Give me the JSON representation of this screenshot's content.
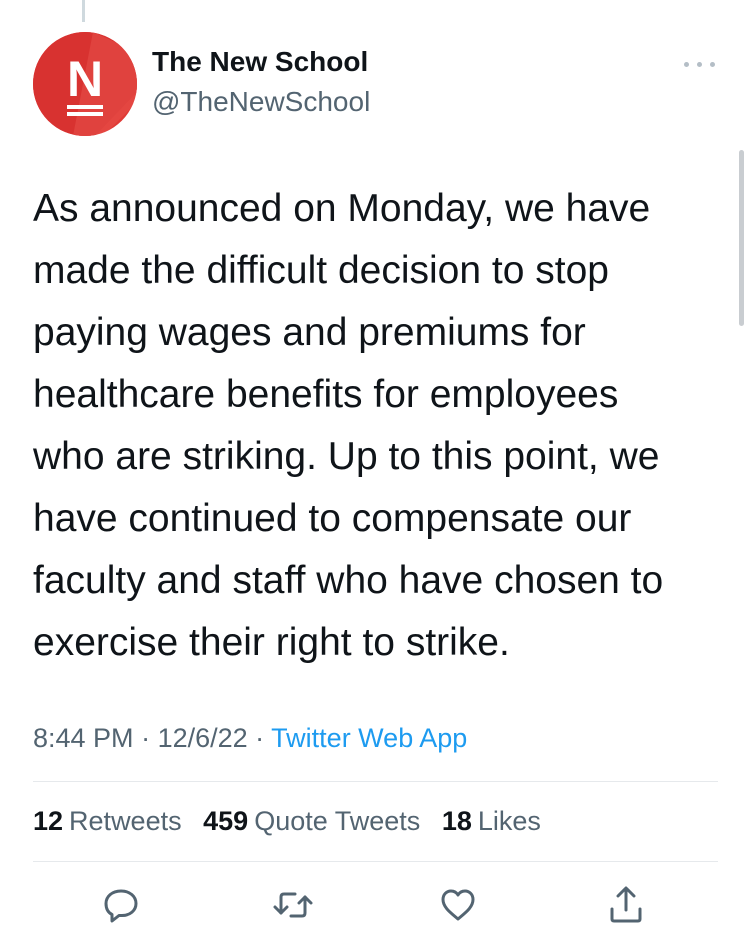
{
  "author": {
    "avatar_letter": "N",
    "display_name": "The New School",
    "handle": "@TheNewSchool"
  },
  "tweet": {
    "lines": [
      "As announced on Monday, we have",
      "made the difficult decision to stop",
      "paying wages and premiums for",
      "healthcare benefits for employees",
      "who are striking. Up to this point, we",
      "have continued to compensate our",
      "faculty and staff who have chosen to",
      "exercise their right to strike."
    ],
    "time": "8:44 PM",
    "separator": " · ",
    "date": "12/6/22",
    "source": "Twitter Web App"
  },
  "stats": {
    "retweets_count": "12",
    "retweets_label": "Retweets",
    "quotes_count": "459",
    "quotes_label": "Quote Tweets",
    "likes_count": "18",
    "likes_label": "Likes"
  },
  "actions": {
    "reply": "reply-icon",
    "retweet": "retweet-icon",
    "like": "heart-icon",
    "share": "share-icon"
  },
  "colors": {
    "avatar_bg": "#e03a36",
    "link": "#1d9bf0",
    "secondary_text": "#536471",
    "primary_text": "#0f1419"
  }
}
